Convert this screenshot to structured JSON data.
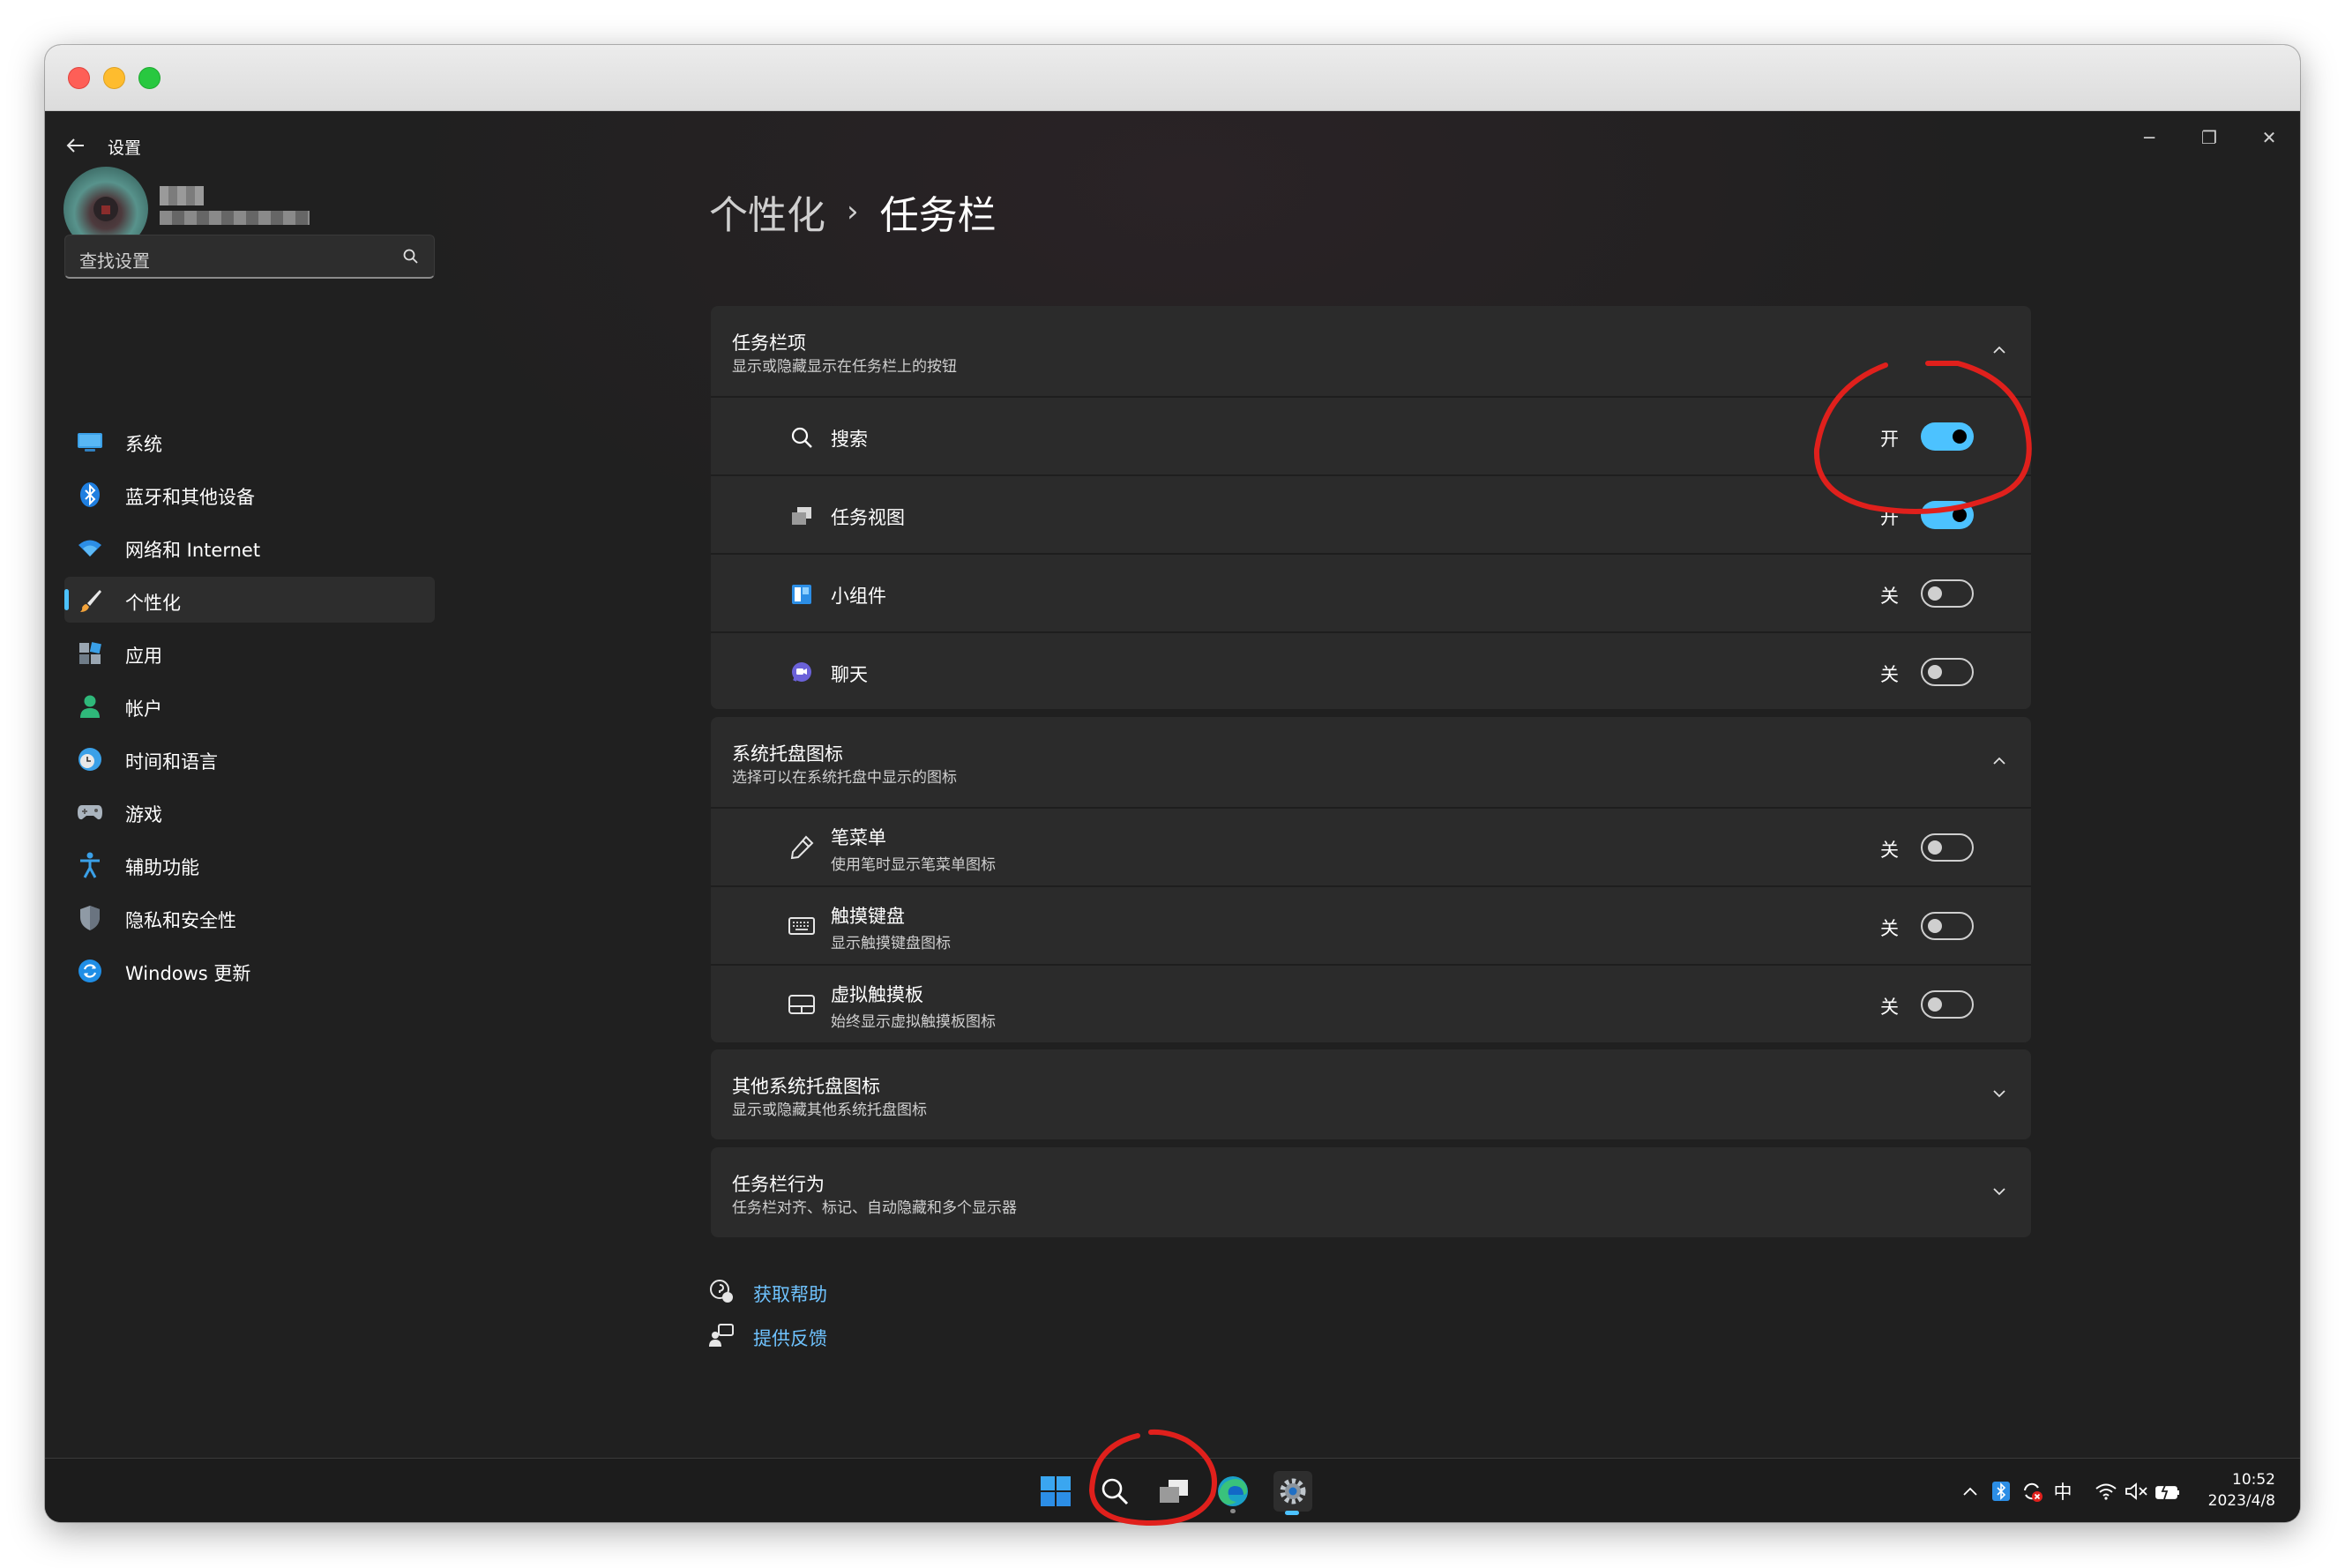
{
  "window": {
    "app_title": "设置",
    "caption_minimize": "─",
    "caption_maximize": "❐",
    "caption_close": "✕"
  },
  "sidebar": {
    "search_placeholder": "查找设置",
    "items": [
      {
        "label": "系统",
        "icon": "display-icon"
      },
      {
        "label": "蓝牙和其他设备",
        "icon": "bluetooth-icon"
      },
      {
        "label": "网络和 Internet",
        "icon": "wifi-icon"
      },
      {
        "label": "个性化",
        "icon": "brush-icon",
        "active": true
      },
      {
        "label": "应用",
        "icon": "apps-icon"
      },
      {
        "label": "帐户",
        "icon": "person-icon"
      },
      {
        "label": "时间和语言",
        "icon": "clock-globe-icon"
      },
      {
        "label": "游戏",
        "icon": "gamepad-icon"
      },
      {
        "label": "辅助功能",
        "icon": "accessibility-icon"
      },
      {
        "label": "隐私和安全性",
        "icon": "shield-icon"
      },
      {
        "label": "Windows 更新",
        "icon": "sync-icon"
      }
    ]
  },
  "breadcrumb": {
    "parent": "个性化",
    "separator": "›",
    "current": "任务栏"
  },
  "taskbar_items": {
    "title": "任务栏项",
    "description": "显示或隐藏显示在任务栏上的按钮",
    "rows": [
      {
        "label": "搜索",
        "state": "开",
        "on": true,
        "icon": "search-icon"
      },
      {
        "label": "任务视图",
        "state": "开",
        "on": true,
        "icon": "task-view-icon"
      },
      {
        "label": "小组件",
        "state": "关",
        "on": false,
        "icon": "widgets-icon"
      },
      {
        "label": "聊天",
        "state": "关",
        "on": false,
        "icon": "chat-icon"
      }
    ]
  },
  "tray_icons": {
    "title": "系统托盘图标",
    "description": "选择可以在系统托盘中显示的图标",
    "rows": [
      {
        "label": "笔菜单",
        "desc": "使用笔时显示笔菜单图标",
        "state": "关",
        "on": false,
        "icon": "pen-icon"
      },
      {
        "label": "触摸键盘",
        "desc": "显示触摸键盘图标",
        "state": "关",
        "on": false,
        "icon": "keyboard-icon"
      },
      {
        "label": "虚拟触摸板",
        "desc": "始终显示虚拟触摸板图标",
        "state": "关",
        "on": false,
        "icon": "touchpad-icon"
      }
    ]
  },
  "other_tray": {
    "title": "其他系统托盘图标",
    "description": "显示或隐藏其他系统托盘图标"
  },
  "behaviors": {
    "title": "任务栏行为",
    "description": "任务栏对齐、标记、自动隐藏和多个显示器"
  },
  "links": {
    "help": "获取帮助",
    "feedback": "提供反馈"
  },
  "system_tray": {
    "ime": "中",
    "time": "10:52",
    "date": "2023/4/8"
  },
  "colors": {
    "accent": "#4cc2ff",
    "annotation": "#e0201c",
    "background": "#202020",
    "card": "#2b2b2b"
  }
}
